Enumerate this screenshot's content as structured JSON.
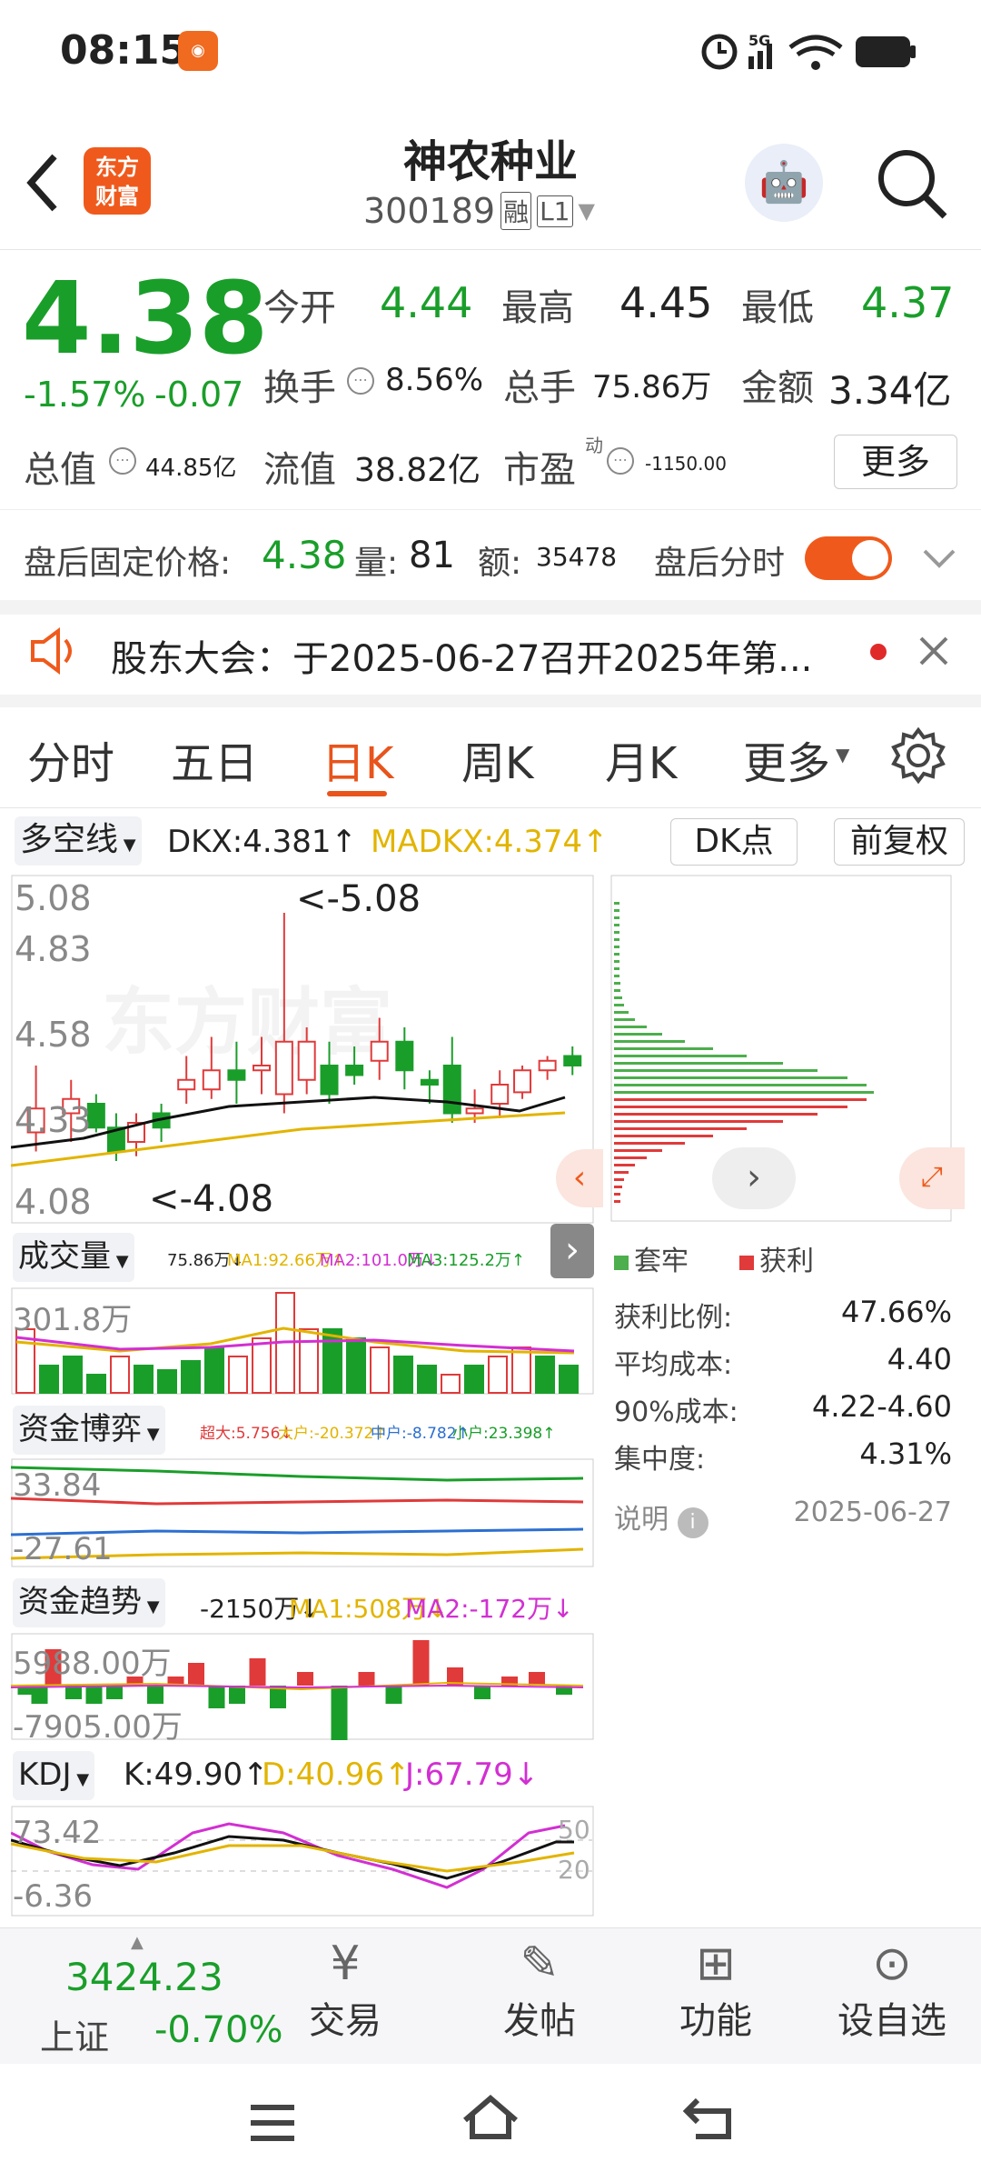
{
  "status": {
    "time": "08:15",
    "network": "5G",
    "battery": "battery-icon"
  },
  "header": {
    "app_badge": "东方\n财富",
    "title": "神农种业",
    "code": "300189",
    "rong": "融",
    "level": "L1"
  },
  "quote": {
    "price": "4.38",
    "change_pct": "-1.57%",
    "change": "-0.07",
    "open_label": "今开",
    "open": "4.44",
    "high_label": "最高",
    "high": "4.45",
    "low_label": "最低",
    "low": "4.37",
    "turnover_label": "换手",
    "turnover": "8.56%",
    "volume_label": "总手",
    "volume": "75.86万",
    "amount_label": "金额",
    "amount": "3.34亿",
    "mktcap_label": "总值",
    "mktcap": "44.85亿",
    "float_label": "流值",
    "float": "38.82亿",
    "pe_label": "市盈",
    "pe_sup": "动",
    "pe": "-1150.00",
    "more": "更多"
  },
  "afterhours": {
    "label": "盘后固定价格:",
    "price": "4.38",
    "vol_label": "量:",
    "vol": "81",
    "amt_label": "额:",
    "amt": "35478",
    "toggle_label": "盘后分时"
  },
  "notice": {
    "text": "股东大会：于2025-06-27召开2025年第..."
  },
  "tabs": [
    "分时",
    "五日",
    "日K",
    "周K",
    "月K",
    "更多"
  ],
  "kchart": {
    "indicator": "多空线",
    "dkx": "DKX:4.381↑",
    "madkx": "MADKX:4.374↑",
    "dk_btn": "DK点",
    "fq_btn": "前复权",
    "y_labels": [
      "5.08",
      "4.83",
      "4.58",
      "4.33",
      "4.08"
    ],
    "max_mark": "<-5.08",
    "min_mark": "<-4.08",
    "watermark": "东方财富"
  },
  "vol": {
    "label": "成交量",
    "v": "75.86万↓",
    "ma1": "MA1:92.66万↑",
    "ma2": "MA2:101.0万↓",
    "ma3": "MA3:125.2万↑",
    "top": "301.8万"
  },
  "fund1": {
    "label": "资金博弈",
    "a": "超大:5.756↓",
    "b": "大户:-20.372↑",
    "c": "中户:-8.782↑",
    "d": "小户:23.398↑",
    "top": "33.84",
    "bot": "-27.61"
  },
  "fund2": {
    "label": "资金趋势",
    "v": "-2150万↓",
    "ma1": "MA1:508万↓",
    "ma2": "MA2:-172万↓",
    "top": "5988.00万",
    "bot": "-7905.00万"
  },
  "kdj": {
    "label": "KDJ",
    "k": "K:49.90↑",
    "d": "D:40.96↑",
    "j": "J:67.79↓",
    "top": "73.42",
    "bot": "-6.36",
    "r1": "50",
    "r2": "20"
  },
  "chip": {
    "legend_loss": "套牢",
    "legend_profit": "获利",
    "rows": [
      {
        "k": "获利比例:",
        "v": "47.66%"
      },
      {
        "k": "平均成本:",
        "v": "4.40"
      },
      {
        "k": "90%成本:",
        "v": "4.22-4.60"
      },
      {
        "k": "集中度:",
        "v": "4.31%"
      }
    ],
    "note": "说明",
    "date": "2025-06-27"
  },
  "bottom": {
    "index_value": "3424.23",
    "index_name": "上证",
    "index_pct": "-0.70%",
    "items": [
      "交易",
      "发帖",
      "功能",
      "设自选"
    ]
  },
  "colors": {
    "red": "#e03a3a",
    "green": "#1a9e2a",
    "orange": "#e8541c",
    "gold": "#e2b400",
    "magenta": "#d22fd2"
  }
}
